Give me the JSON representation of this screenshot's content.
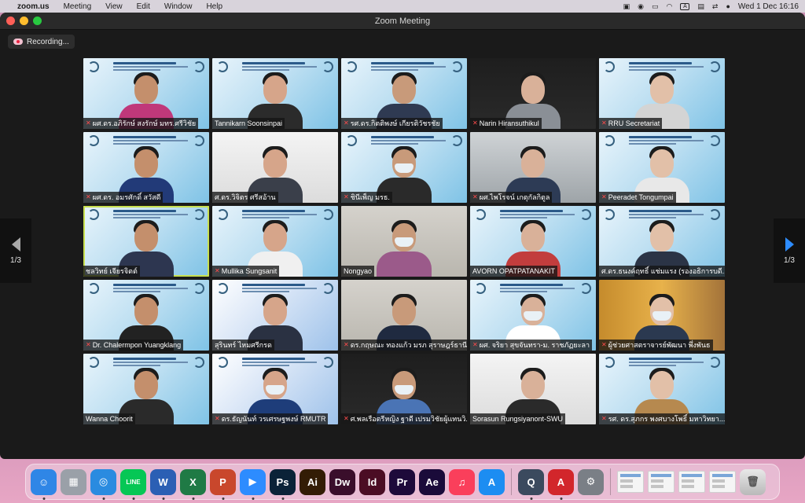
{
  "menubar": {
    "app_name": "zoom.us",
    "menus": [
      "Meeting",
      "View",
      "Edit",
      "Window",
      "Help"
    ],
    "clock": "Wed 1 Dec  16:16"
  },
  "window": {
    "title": "Zoom Meeting",
    "recording_label": "Recording...",
    "page_indicator_left": "1/3",
    "page_indicator_right": "1/3"
  },
  "participants": [
    {
      "name": "ผศ.ดร.อภิรักษ์ สงรักษ์  มทร.ศรีวิชัย",
      "muted": true
    },
    {
      "name": "Tannikarn Soonsinpai",
      "muted": false
    },
    {
      "name": "รศ.ดร.กิตติพงษ์ เกียรติวัชรชัย",
      "muted": true
    },
    {
      "name": "Narin Hiransuthikul",
      "muted": true
    },
    {
      "name": "RRU Secretariat",
      "muted": true
    },
    {
      "name": "ผศ.ดร. อมรศักดิ์ สวัสดี",
      "muted": true
    },
    {
      "name": "ศ.ดร.วิจิตร ศรีสอ้าน",
      "muted": false
    },
    {
      "name": "ชินีเพ็ญ มรธ.",
      "muted": true
    },
    {
      "name": "ผศ.ไพโรจน์ เกตุกัลกิตูล",
      "muted": true
    },
    {
      "name": "Peeradet Tongumpai",
      "muted": true
    },
    {
      "name": "ชลวิทย์ เจียรจิตต์",
      "muted": false
    },
    {
      "name": "Mullika Sungsanit",
      "muted": true
    },
    {
      "name": "Nongyao",
      "muted": false
    },
    {
      "name": "AVORN OPATPATANAKIT",
      "muted": false
    },
    {
      "name": "ศ.ดร.ธนงค์ฤทธิ์ แช่มแรง (รองอธิการบดี...",
      "muted": false
    },
    {
      "name": "Dr. Chalermpon Yuangklang",
      "muted": true
    },
    {
      "name": "สุรินทร์ ไหมศรีกรด",
      "muted": false
    },
    {
      "name": "ดร.กฤษณะ ทองแก้ว มรภ สุราษฎร์ธานี",
      "muted": true
    },
    {
      "name": "ผศ. จริยา สุขจันทรา-ม. ราชภัฏยะลา",
      "muted": true
    },
    {
      "name": "ผู้ช่วยศาสตราจารย์พัฒนา  พึ่งพันธ",
      "muted": true
    },
    {
      "name": "Wanna Choorit",
      "muted": false
    },
    {
      "name": "ดร.ธัญนันท์ วรเศรษฐพงษ์ RMUTR",
      "muted": true
    },
    {
      "name": "ศ.พลเรือตรีหญิง ฐาดี เปรมวิชัยผู้แทนวิ...",
      "muted": true
    },
    {
      "name": "Sorasun Rungsiyanont-SWU",
      "muted": false
    },
    {
      "name": "รศ. ดร.สุภกร พงศบางโพธิ์ มหาวิทยา...",
      "muted": true
    }
  ],
  "dock": {
    "apps": [
      {
        "name": "finder-icon",
        "glyph": "☺",
        "color": "#2f86e6",
        "running": true
      },
      {
        "name": "launchpad-icon",
        "glyph": "▦",
        "color": "#9aa0a8",
        "running": false
      },
      {
        "name": "safari-icon",
        "glyph": "◎",
        "color": "#2a8be0",
        "running": true
      },
      {
        "name": "line-icon",
        "glyph": "LINE",
        "color": "#06c755",
        "running": true
      },
      {
        "name": "word-icon",
        "glyph": "W",
        "color": "#2b5fb4",
        "running": true
      },
      {
        "name": "excel-icon",
        "glyph": "X",
        "color": "#1f7a45",
        "running": true
      },
      {
        "name": "powerpoint-icon",
        "glyph": "P",
        "color": "#c9472c",
        "running": true
      },
      {
        "name": "zoom-icon",
        "glyph": "▶",
        "color": "#2d8cff",
        "running": true
      },
      {
        "name": "photoshop-icon",
        "glyph": "Ps",
        "color": "#0b2238",
        "running": true
      },
      {
        "name": "illustrator-icon",
        "glyph": "Ai",
        "color": "#331c05",
        "running": false
      },
      {
        "name": "dreamweaver-icon",
        "glyph": "Dw",
        "color": "#3a0e2b",
        "running": false
      },
      {
        "name": "indesign-icon",
        "glyph": "Id",
        "color": "#4b0d24",
        "running": false
      },
      {
        "name": "premiere-icon",
        "glyph": "Pr",
        "color": "#1d0a3a",
        "running": false
      },
      {
        "name": "after-effects-icon",
        "glyph": "Ae",
        "color": "#1a0b3a",
        "running": false
      },
      {
        "name": "music-icon",
        "glyph": "♫",
        "color": "#fa3f5b",
        "running": false
      },
      {
        "name": "app-store-icon",
        "glyph": "A",
        "color": "#1c8df2",
        "running": false
      }
    ],
    "apps_right": [
      {
        "name": "quicktime-icon",
        "glyph": "Q",
        "color": "#3b4a5e",
        "running": true
      },
      {
        "name": "acrobat-icon",
        "glyph": "A",
        "color": "#d2262b",
        "running": true
      },
      {
        "name": "system-preferences-icon",
        "glyph": "⚙",
        "color": "#7a7f86",
        "running": false
      }
    ]
  }
}
